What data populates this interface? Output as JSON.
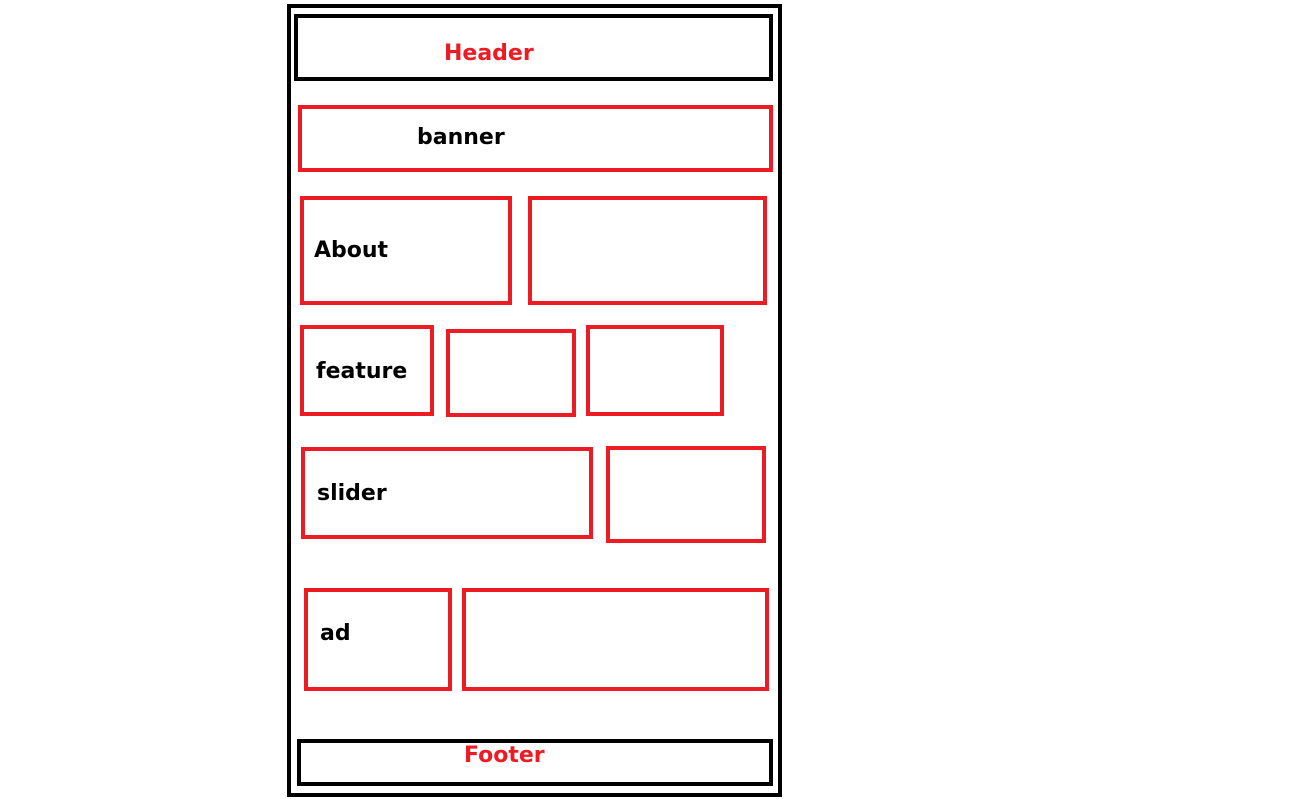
{
  "colors": {
    "outline": "#000000",
    "section": "#ed1c24",
    "heading_text": "#ed1c24",
    "label_text": "#000000"
  },
  "header": {
    "label": "Header"
  },
  "banner": {
    "label": "banner"
  },
  "about": {
    "label": "About"
  },
  "feature": {
    "label": "feature"
  },
  "slider": {
    "label": "slider"
  },
  "ad": {
    "label": "ad"
  },
  "footer": {
    "label": "Footer"
  }
}
